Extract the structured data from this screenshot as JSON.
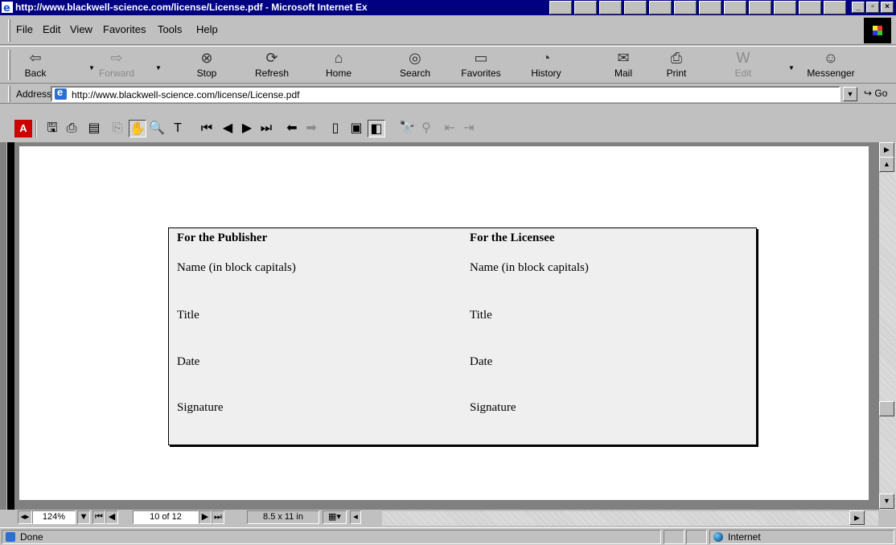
{
  "window": {
    "title": "http://www.blackwell-science.com/license/License.pdf - Microsoft Internet Ex",
    "minimize": "_",
    "maximize": "▫",
    "close": "×"
  },
  "menu": [
    "File",
    "Edit",
    "View",
    "Favorites",
    "Tools",
    "Help"
  ],
  "toolbar": {
    "back": "Back",
    "forward": "Forward",
    "stop": "Stop",
    "refresh": "Refresh",
    "home": "Home",
    "search": "Search",
    "favorites": "Favorites",
    "history": "History",
    "mail": "Mail",
    "print": "Print",
    "edit": "Edit",
    "messenger": "Messenger"
  },
  "address": {
    "label": "Address",
    "value": "http://www.blackwell-science.com/license/License.pdf",
    "go": "Go"
  },
  "document": {
    "publisher_header": "For the Publisher",
    "licensee_header": "For the Licensee",
    "rows": [
      {
        "left": "Name (in block capitals)",
        "right": "Name (in block capitals)"
      },
      {
        "left": "Title",
        "right": "Title"
      },
      {
        "left": "Date",
        "right": "Date"
      },
      {
        "left": "Signature",
        "right": "Signature"
      }
    ]
  },
  "pdf_status": {
    "zoom": "124%",
    "page": "10 of 12",
    "page_size": "8.5 x 11 in"
  },
  "status": {
    "text": "Done",
    "zone": "Internet"
  }
}
